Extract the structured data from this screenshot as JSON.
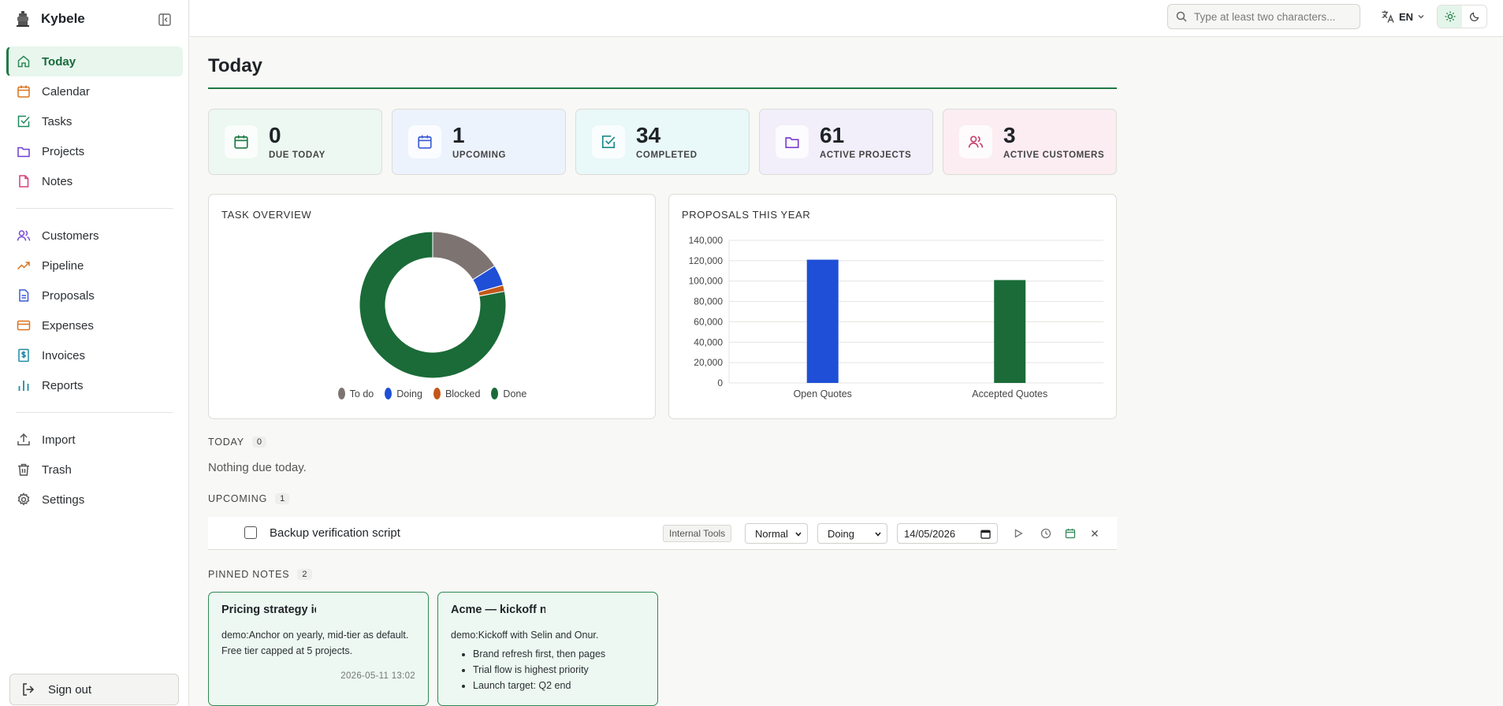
{
  "app": {
    "name": "Kybele"
  },
  "nav": {
    "group1": [
      {
        "label": "Today",
        "icon": "home-icon",
        "color": "#2f8a55",
        "active": true
      },
      {
        "label": "Calendar",
        "icon": "calendar-icon",
        "color": "#d9731f"
      },
      {
        "label": "Tasks",
        "icon": "check-square-icon",
        "color": "#1f8a5a"
      },
      {
        "label": "Projects",
        "icon": "folder-icon",
        "color": "#6d3fd1"
      },
      {
        "label": "Notes",
        "icon": "note-icon",
        "color": "#d63f7a"
      }
    ],
    "group2": [
      {
        "label": "Customers",
        "icon": "users-icon",
        "color": "#7b4bd6"
      },
      {
        "label": "Pipeline",
        "icon": "trending-up-icon",
        "color": "#d9731f"
      },
      {
        "label": "Proposals",
        "icon": "document-icon",
        "color": "#3b5bd6"
      },
      {
        "label": "Expenses",
        "icon": "credit-card-icon",
        "color": "#d9731f"
      },
      {
        "label": "Invoices",
        "icon": "invoice-icon",
        "color": "#1f8aa6"
      },
      {
        "label": "Reports",
        "icon": "bar-chart-icon",
        "color": "#1f8aa6"
      }
    ],
    "group3": [
      {
        "label": "Import",
        "icon": "upload-icon",
        "color": "#555"
      },
      {
        "label": "Trash",
        "icon": "trash-icon",
        "color": "#555"
      },
      {
        "label": "Settings",
        "icon": "gear-icon",
        "color": "#555"
      }
    ],
    "signout": "Sign out"
  },
  "topbar": {
    "search_placeholder": "Type at least two characters...",
    "lang": "EN"
  },
  "page": {
    "title": "Today"
  },
  "stats": [
    {
      "value": "0",
      "label": "DUE TODAY",
      "bg": "#ecf8f1",
      "icon_color": "#1f7a44",
      "icon": "calendar-icon"
    },
    {
      "value": "1",
      "label": "UPCOMING",
      "bg": "#edf3fd",
      "icon_color": "#3b5bd6",
      "icon": "calendar-icon"
    },
    {
      "value": "34",
      "label": "COMPLETED",
      "bg": "#e9f8f8",
      "icon_color": "#1f8a8a",
      "icon": "check-square-icon"
    },
    {
      "value": "61",
      "label": "ACTIVE PROJECTS",
      "bg": "#f2effa",
      "icon_color": "#7b3fd1",
      "icon": "folder-icon"
    },
    {
      "value": "3",
      "label": "ACTIVE CUSTOMERS",
      "bg": "#fcedf3",
      "icon_color": "#c83f6a",
      "icon": "users-icon"
    }
  ],
  "task_overview": {
    "title": "TASK OVERVIEW"
  },
  "proposals": {
    "title": "PROPOSALS THIS YEAR"
  },
  "chart_data": [
    {
      "type": "pie",
      "title": "TASK OVERVIEW",
      "donut": true,
      "labels": [
        "To do",
        "Doing",
        "Blocked",
        "Done"
      ],
      "values": [
        7,
        2,
        0.6,
        34
      ],
      "colors": [
        "#7d7472",
        "#1f4fd6",
        "#c2581a",
        "#1a6b38"
      ],
      "legend": "bottom"
    },
    {
      "type": "bar",
      "title": "PROPOSALS THIS YEAR",
      "categories": [
        "Open Quotes",
        "Accepted Quotes"
      ],
      "values": [
        121000,
        101000
      ],
      "colors": [
        "#1f4fd6",
        "#1a6b38"
      ],
      "ylim": [
        0,
        140000
      ],
      "yticks": [
        0,
        20000,
        40000,
        60000,
        80000,
        100000,
        120000,
        140000
      ],
      "ytick_labels": [
        "0",
        "20,000",
        "40,000",
        "60,000",
        "80,000",
        "100,000",
        "120,000",
        "140,000"
      ],
      "grid": true
    }
  ],
  "sections": {
    "today": {
      "label": "TODAY",
      "count": "0",
      "empty": "Nothing due today."
    },
    "upcoming": {
      "label": "UPCOMING",
      "count": "1"
    },
    "pinned": {
      "label": "PINNED NOTES",
      "count": "2"
    }
  },
  "upcoming_task": {
    "name": "Backup verification script",
    "project": "Internal Tools",
    "priority": "Normal",
    "status": "Doing",
    "due": "14/05/2026"
  },
  "notes": [
    {
      "title": "Pricing strategy id",
      "body": "demo:Anchor on yearly, mid-tier as default. Free tier capped at 5 projects.",
      "date": "2026-05-11 13:02"
    },
    {
      "title": "Acme — kickoff n",
      "body": "demo:Kickoff with Selin and Onur.",
      "bullets": [
        "Brand refresh first, then pages",
        "Trial flow is highest priority",
        "Launch target: Q2 end"
      ]
    }
  ]
}
